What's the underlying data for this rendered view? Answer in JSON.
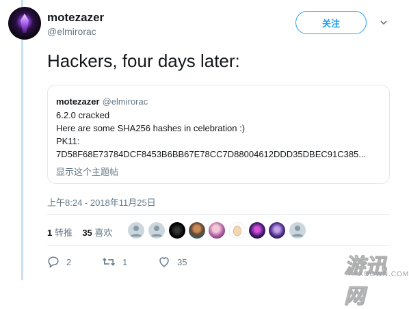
{
  "tweet": {
    "display_name": "motezazer",
    "handle": "@elmirorac",
    "follow_label": "关注",
    "text": "Hackers, four days later:",
    "timestamp": "上午8:24 - 2018年11月25日"
  },
  "quote": {
    "display_name": "motezazer",
    "handle": "@elmirorac",
    "lines": [
      "6.2.0 cracked",
      "Here are some SHA256 hashes in celebration :)",
      "PK11:",
      "7D58F68E73784DCF8453B6BB67E78CC7D88004612DDD35DBEC91C385..."
    ],
    "show_thread": "显示这个主题帖"
  },
  "stats": {
    "retweets_count": "1",
    "retweets_label": "转推",
    "likes_count": "35",
    "likes_label": "喜欢"
  },
  "actions": {
    "reply_count": "2",
    "retweet_count": "1",
    "like_count": "35"
  },
  "watermark": {
    "main": "游迅网",
    "sub": "YXDOWN.COM"
  },
  "colors": {
    "accent": "#1da1f2",
    "secondary_text": "#657786",
    "border": "#e1e8ed"
  }
}
